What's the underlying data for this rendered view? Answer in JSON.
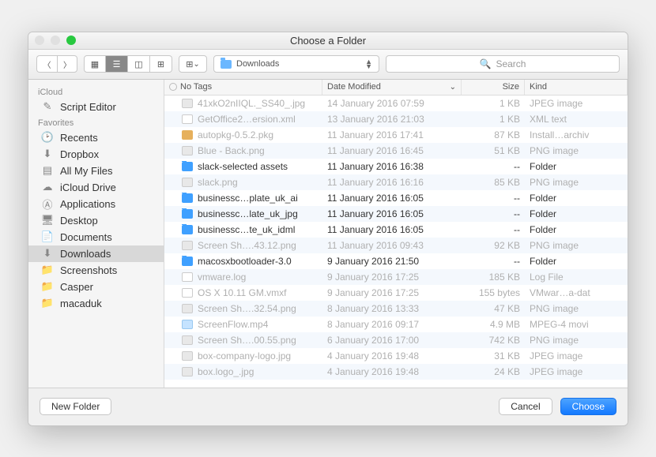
{
  "window": {
    "title": "Choose a Folder"
  },
  "toolbar": {
    "path_label": "Downloads",
    "search_placeholder": "Search"
  },
  "sidebar": {
    "sections": [
      {
        "label": "iCloud",
        "items": [
          {
            "name": "Script Editor",
            "icon": "script"
          }
        ]
      },
      {
        "label": "Favorites",
        "items": [
          {
            "name": "Recents",
            "icon": "clock"
          },
          {
            "name": "Dropbox",
            "icon": "dropbox"
          },
          {
            "name": "All My Files",
            "icon": "stack"
          },
          {
            "name": "iCloud Drive",
            "icon": "cloud"
          },
          {
            "name": "Applications",
            "icon": "app"
          },
          {
            "name": "Desktop",
            "icon": "desktop"
          },
          {
            "name": "Documents",
            "icon": "doc"
          },
          {
            "name": "Downloads",
            "icon": "download",
            "selected": true
          },
          {
            "name": "Screenshots",
            "icon": "folder"
          },
          {
            "name": "Casper",
            "icon": "folder"
          },
          {
            "name": "macaduk",
            "icon": "folder"
          }
        ]
      }
    ]
  },
  "columns": {
    "name": "No Tags",
    "date": "Date Modified",
    "size": "Size",
    "kind": "Kind"
  },
  "files": [
    {
      "name": "41xkO2nIIQL._SS40_.jpg",
      "date": "14 January 2016 07:59",
      "size": "1 KB",
      "kind": "JPEG image",
      "dim": true,
      "icon": "img"
    },
    {
      "name": "GetOffice2…ersion.xml",
      "date": "13 January 2016 21:03",
      "size": "1 KB",
      "kind": "XML text",
      "dim": true,
      "icon": "doc"
    },
    {
      "name": "autopkg-0.5.2.pkg",
      "date": "11 January 2016 17:41",
      "size": "87 KB",
      "kind": "Install…archiv",
      "dim": true,
      "icon": "box"
    },
    {
      "name": "Blue - Back.png",
      "date": "11 January 2016 16:45",
      "size": "51 KB",
      "kind": "PNG image",
      "dim": true,
      "icon": "img"
    },
    {
      "name": "slack-selected assets",
      "date": "11 January 2016 16:38",
      "size": "--",
      "kind": "Folder",
      "dim": false,
      "icon": "folder"
    },
    {
      "name": "slack.png",
      "date": "11 January 2016 16:16",
      "size": "85 KB",
      "kind": "PNG image",
      "dim": true,
      "icon": "img"
    },
    {
      "name": "businessc…plate_uk_ai",
      "date": "11 January 2016 16:05",
      "size": "--",
      "kind": "Folder",
      "dim": false,
      "icon": "folder"
    },
    {
      "name": "businessc…late_uk_jpg",
      "date": "11 January 2016 16:05",
      "size": "--",
      "kind": "Folder",
      "dim": false,
      "icon": "folder"
    },
    {
      "name": "businessc…te_uk_idml",
      "date": "11 January 2016 16:05",
      "size": "--",
      "kind": "Folder",
      "dim": false,
      "icon": "folder"
    },
    {
      "name": "Screen Sh….43.12.png",
      "date": "11 January 2016 09:43",
      "size": "92 KB",
      "kind": "PNG image",
      "dim": true,
      "icon": "img"
    },
    {
      "name": "macosxbootloader-3.0",
      "date": "9 January 2016 21:50",
      "size": "--",
      "kind": "Folder",
      "dim": false,
      "icon": "folder"
    },
    {
      "name": "vmware.log",
      "date": "9 January 2016 17:25",
      "size": "185 KB",
      "kind": "Log File",
      "dim": true,
      "icon": "doc"
    },
    {
      "name": "OS X 10.11 GM.vmxf",
      "date": "9 January 2016 17:25",
      "size": "155 bytes",
      "kind": "VMwar…a-dat",
      "dim": true,
      "icon": "doc"
    },
    {
      "name": "Screen Sh….32.54.png",
      "date": "8 January 2016 13:33",
      "size": "47 KB",
      "kind": "PNG image",
      "dim": true,
      "icon": "img"
    },
    {
      "name": "ScreenFlow.mp4",
      "date": "8 January 2016 09:17",
      "size": "4.9 MB",
      "kind": "MPEG-4 movi",
      "dim": true,
      "icon": "mov"
    },
    {
      "name": "Screen Sh….00.55.png",
      "date": "6 January 2016 17:00",
      "size": "742 KB",
      "kind": "PNG image",
      "dim": true,
      "icon": "img"
    },
    {
      "name": "box-company-logo.jpg",
      "date": "4 January 2016 19:48",
      "size": "31 KB",
      "kind": "JPEG image",
      "dim": true,
      "icon": "img"
    },
    {
      "name": "box.logo_.jpg",
      "date": "4 January 2016 19:48",
      "size": "24 KB",
      "kind": "JPEG image",
      "dim": true,
      "icon": "img"
    }
  ],
  "footer": {
    "new_folder": "New Folder",
    "cancel": "Cancel",
    "choose": "Choose"
  }
}
